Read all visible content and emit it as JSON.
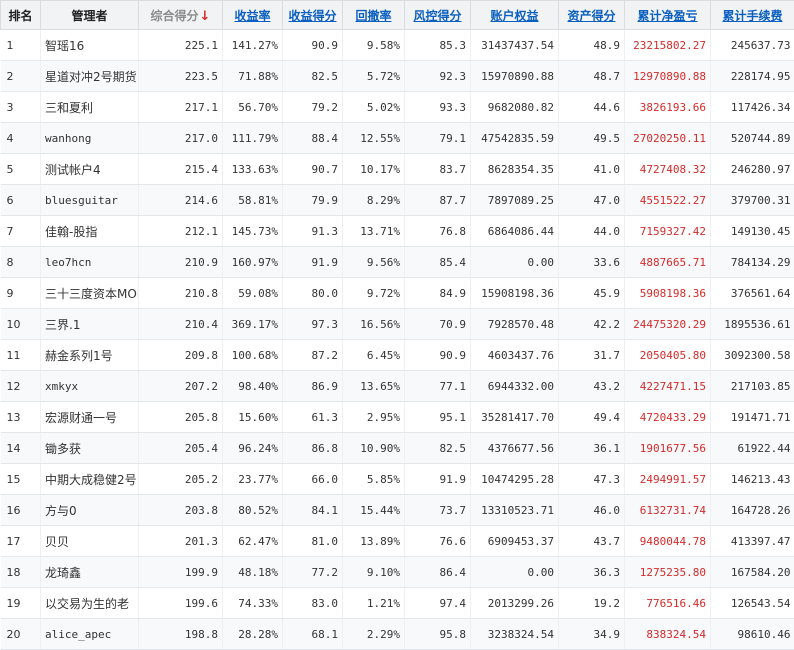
{
  "table": {
    "headers": [
      {
        "key": "rank",
        "label": "排名",
        "style": "plain"
      },
      {
        "key": "manager",
        "label": "管理者",
        "style": "plain"
      },
      {
        "key": "composite",
        "label": "综合得分",
        "style": "sorted",
        "arrow": "↓"
      },
      {
        "key": "return_rate",
        "label": "收益率",
        "style": "link"
      },
      {
        "key": "return_score",
        "label": "收益得分",
        "style": "link"
      },
      {
        "key": "drawdown",
        "label": "回撤率",
        "style": "link"
      },
      {
        "key": "risk_score",
        "label": "风控得分",
        "style": "link"
      },
      {
        "key": "equity",
        "label": "账户权益",
        "style": "link"
      },
      {
        "key": "asset_score",
        "label": "资产得分",
        "style": "link"
      },
      {
        "key": "cum_pnl",
        "label": "累计净盈亏",
        "style": "link"
      },
      {
        "key": "cum_fee",
        "label": "累计手续费",
        "style": "link"
      }
    ],
    "rows": [
      {
        "rank": "1",
        "manager": "智瑶16",
        "composite": "225.1",
        "return_rate": "141.27%",
        "return_score": "90.9",
        "drawdown": "9.58%",
        "risk_score": "85.3",
        "equity": "31437437.54",
        "asset_score": "48.9",
        "cum_pnl": "23215802.27",
        "cum_fee": "245637.73"
      },
      {
        "rank": "2",
        "manager": "星道对冲2号期货",
        "composite": "223.5",
        "return_rate": "71.88%",
        "return_score": "82.5",
        "drawdown": "5.72%",
        "risk_score": "92.3",
        "equity": "15970890.88",
        "asset_score": "48.7",
        "cum_pnl": "12970890.88",
        "cum_fee": "228174.95"
      },
      {
        "rank": "3",
        "manager": "三和夏利",
        "composite": "217.1",
        "return_rate": "56.70%",
        "return_score": "79.2",
        "drawdown": "5.02%",
        "risk_score": "93.3",
        "equity": "9682080.82",
        "asset_score": "44.6",
        "cum_pnl": "3826193.66",
        "cum_fee": "117426.34"
      },
      {
        "rank": "4",
        "manager": "wanhong",
        "composite": "217.0",
        "return_rate": "111.79%",
        "return_score": "88.4",
        "drawdown": "12.55%",
        "risk_score": "79.1",
        "equity": "47542835.59",
        "asset_score": "49.5",
        "cum_pnl": "27020250.11",
        "cum_fee": "520744.89"
      },
      {
        "rank": "5",
        "manager": "测试帐户4",
        "composite": "215.4",
        "return_rate": "133.63%",
        "return_score": "90.7",
        "drawdown": "10.17%",
        "risk_score": "83.7",
        "equity": "8628354.35",
        "asset_score": "41.0",
        "cum_pnl": "4727408.32",
        "cum_fee": "246280.97"
      },
      {
        "rank": "6",
        "manager": "bluesguitar",
        "composite": "214.6",
        "return_rate": "58.81%",
        "return_score": "79.9",
        "drawdown": "8.29%",
        "risk_score": "87.7",
        "equity": "7897089.25",
        "asset_score": "47.0",
        "cum_pnl": "4551522.27",
        "cum_fee": "379700.31"
      },
      {
        "rank": "7",
        "manager": "佳翰-股指",
        "composite": "212.1",
        "return_rate": "145.73%",
        "return_score": "91.3",
        "drawdown": "13.71%",
        "risk_score": "76.8",
        "equity": "6864086.44",
        "asset_score": "44.0",
        "cum_pnl": "7159327.42",
        "cum_fee": "149130.45"
      },
      {
        "rank": "8",
        "manager": "leo7hcn",
        "composite": "210.9",
        "return_rate": "160.97%",
        "return_score": "91.9",
        "drawdown": "9.56%",
        "risk_score": "85.4",
        "equity": "0.00",
        "asset_score": "33.6",
        "cum_pnl": "4887665.71",
        "cum_fee": "784134.29"
      },
      {
        "rank": "9",
        "manager": "三十三度资本MOM",
        "composite": "210.8",
        "return_rate": "59.08%",
        "return_score": "80.0",
        "drawdown": "9.72%",
        "risk_score": "84.9",
        "equity": "15908198.36",
        "asset_score": "45.9",
        "cum_pnl": "5908198.36",
        "cum_fee": "376561.64"
      },
      {
        "rank": "10",
        "manager": "三界.1",
        "composite": "210.4",
        "return_rate": "369.17%",
        "return_score": "97.3",
        "drawdown": "16.56%",
        "risk_score": "70.9",
        "equity": "7928570.48",
        "asset_score": "42.2",
        "cum_pnl": "24475320.29",
        "cum_fee": "1895536.61"
      },
      {
        "rank": "11",
        "manager": "赫金系列1号",
        "composite": "209.8",
        "return_rate": "100.68%",
        "return_score": "87.2",
        "drawdown": "6.45%",
        "risk_score": "90.9",
        "equity": "4603437.76",
        "asset_score": "31.7",
        "cum_pnl": "2050405.80",
        "cum_fee": "3092300.58"
      },
      {
        "rank": "12",
        "manager": "xmkyx",
        "composite": "207.2",
        "return_rate": "98.40%",
        "return_score": "86.9",
        "drawdown": "13.65%",
        "risk_score": "77.1",
        "equity": "6944332.00",
        "asset_score": "43.2",
        "cum_pnl": "4227471.15",
        "cum_fee": "217103.85"
      },
      {
        "rank": "13",
        "manager": "宏源财通一号",
        "composite": "205.8",
        "return_rate": "15.60%",
        "return_score": "61.3",
        "drawdown": "2.95%",
        "risk_score": "95.1",
        "equity": "35281417.70",
        "asset_score": "49.4",
        "cum_pnl": "4720433.29",
        "cum_fee": "191471.71"
      },
      {
        "rank": "14",
        "manager": "锄多获",
        "composite": "205.4",
        "return_rate": "96.24%",
        "return_score": "86.8",
        "drawdown": "10.90%",
        "risk_score": "82.5",
        "equity": "4376677.56",
        "asset_score": "36.1",
        "cum_pnl": "1901677.56",
        "cum_fee": "61922.44"
      },
      {
        "rank": "15",
        "manager": "中期大成稳健2号",
        "composite": "205.2",
        "return_rate": "23.77%",
        "return_score": "66.0",
        "drawdown": "5.85%",
        "risk_score": "91.9",
        "equity": "10474295.28",
        "asset_score": "47.3",
        "cum_pnl": "2494991.57",
        "cum_fee": "146213.43"
      },
      {
        "rank": "16",
        "manager": "方与0",
        "composite": "203.8",
        "return_rate": "80.52%",
        "return_score": "84.1",
        "drawdown": "15.44%",
        "risk_score": "73.7",
        "equity": "13310523.71",
        "asset_score": "46.0",
        "cum_pnl": "6132731.74",
        "cum_fee": "164728.26"
      },
      {
        "rank": "17",
        "manager": "贝贝",
        "composite": "201.3",
        "return_rate": "62.47%",
        "return_score": "81.0",
        "drawdown": "13.89%",
        "risk_score": "76.6",
        "equity": "6909453.37",
        "asset_score": "43.7",
        "cum_pnl": "9480044.78",
        "cum_fee": "413397.47"
      },
      {
        "rank": "18",
        "manager": "龙琦鑫",
        "composite": "199.9",
        "return_rate": "48.18%",
        "return_score": "77.2",
        "drawdown": "9.10%",
        "risk_score": "86.4",
        "equity": "0.00",
        "asset_score": "36.3",
        "cum_pnl": "1275235.80",
        "cum_fee": "167584.20"
      },
      {
        "rank": "19",
        "manager": "以交易为生的老",
        "composite": "199.6",
        "return_rate": "74.33%",
        "return_score": "83.0",
        "drawdown": "1.21%",
        "risk_score": "97.4",
        "equity": "2013299.26",
        "asset_score": "19.2",
        "cum_pnl": "776516.46",
        "cum_fee": "126543.54"
      },
      {
        "rank": "20",
        "manager": "alice_apec",
        "composite": "198.8",
        "return_rate": "28.28%",
        "return_score": "68.1",
        "drawdown": "2.29%",
        "risk_score": "95.8",
        "equity": "3238324.54",
        "asset_score": "34.9",
        "cum_pnl": "838324.54",
        "cum_fee": "98610.46"
      }
    ]
  },
  "colors": {
    "header_bg": "#f1f3f5",
    "link": "#0b5fbf",
    "pnl": "#d42a2a",
    "sort_arrow": "#d42a2a",
    "row_alt": "#f7f9fb"
  }
}
